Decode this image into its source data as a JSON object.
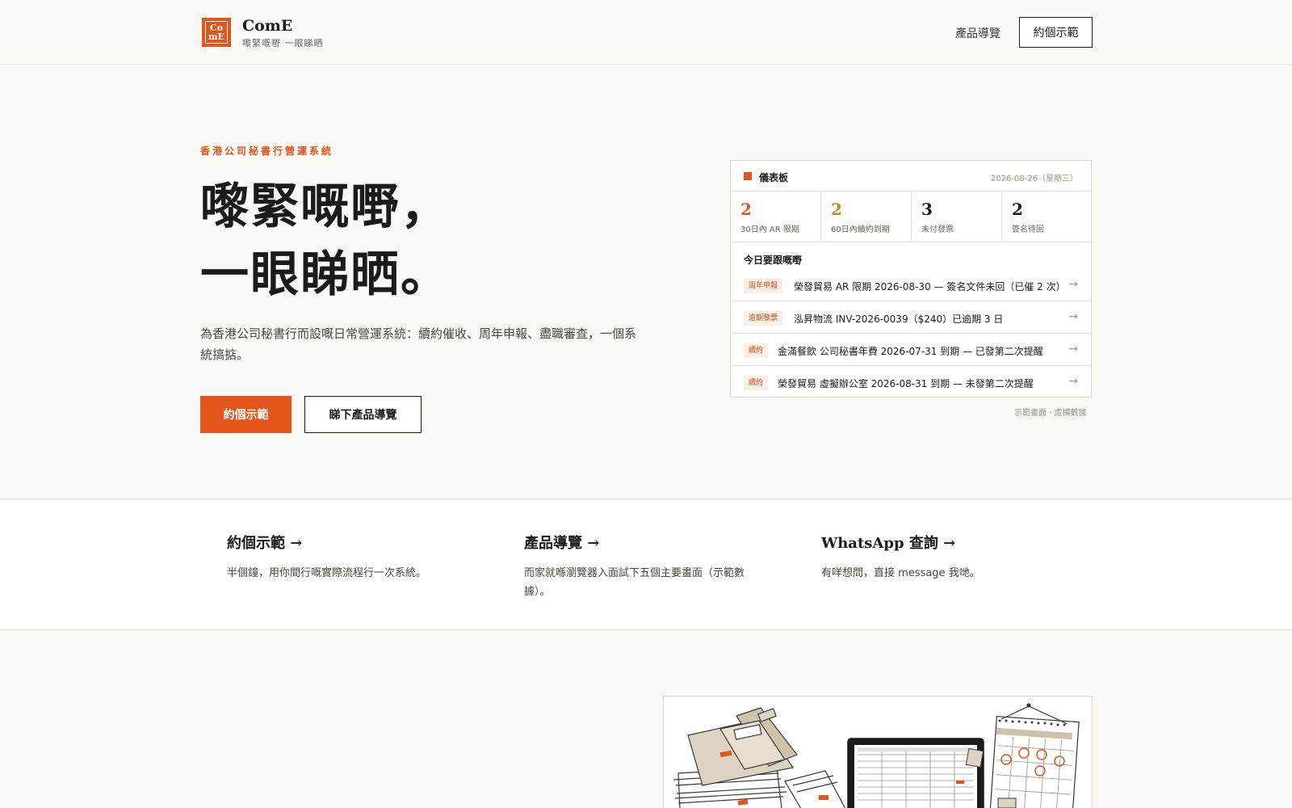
{
  "header": {
    "logo_text_top": "Co",
    "logo_text_bottom": "mE",
    "brand_name": "ComE",
    "brand_tagline": "嚟緊嘅嘢 一眼睇晒",
    "nav_link": "產品導覽",
    "nav_button": "約個示範"
  },
  "hero": {
    "eyebrow": "香港公司秘書行營運系統",
    "title_line1": "嚟緊嘅嘢，",
    "title_line2": "一眼睇晒。",
    "description": "為香港公司秘書行而設嘅日常營運系統：續約催收、周年申報、盡職審查，一個系統搞掂。",
    "primary_button": "約個示範",
    "secondary_button": "睇下產品導覽"
  },
  "dashboard": {
    "title": "儀表板",
    "date": "2026-08-26（星期三）",
    "stats": [
      {
        "value": "2",
        "label": "30日內 AR 限期",
        "color": "#e2561c"
      },
      {
        "value": "2",
        "label": "60日內續約到期",
        "color": "#c98a1a"
      },
      {
        "value": "3",
        "label": "未付發票",
        "color": "#1c1b19"
      },
      {
        "value": "2",
        "label": "簽名待回",
        "color": "#1c1b19"
      }
    ],
    "today_title": "今日要跟嘅嘢",
    "tasks": [
      {
        "tag": "周年申報",
        "text": "榮發貿易 AR 限期 2026-08-30 — 簽名文件未回（已催 2 次）",
        "arrow": "→"
      },
      {
        "tag": "逾期發票",
        "text": "泓昇物流 INV-2026-0039（$240）已逾期 3 日",
        "arrow": "→"
      },
      {
        "tag": "續約",
        "text": "金滿餐飲 公司秘書年費 2026-07-31 到期 — 已發第二次提醒",
        "arrow": "→"
      },
      {
        "tag": "續約",
        "text": "榮發貿易 虛擬辦公室 2026-08-31 到期 — 未發第二次提醒",
        "arrow": "→"
      }
    ],
    "note": "示範畫面 · 虛構數據"
  },
  "links": [
    {
      "title": "約個示範 →",
      "description": "半個鐘，用你間行嘅實際流程行一次系統。"
    },
    {
      "title": "產品導覽 →",
      "description": "而家就喺瀏覽器入面試下五個主要畫面（示範數據）。"
    },
    {
      "title": "WhatsApp 查詢 →",
      "description": "有咩想問，直接 message 我哋。"
    }
  ],
  "colors": {
    "accent": "#e2561c",
    "background": "#faf9f6",
    "text": "#1c1b19"
  }
}
